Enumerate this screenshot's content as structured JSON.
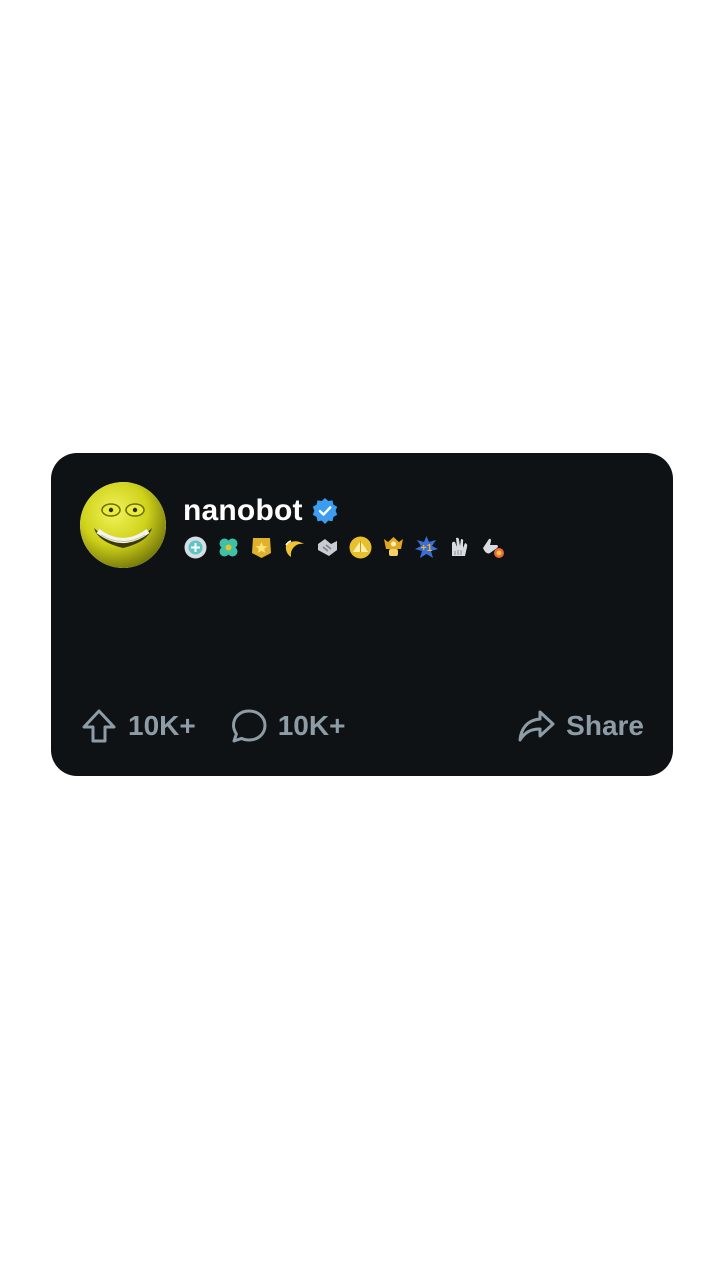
{
  "post": {
    "username": "nanobot",
    "verified": true,
    "badges": [
      {
        "icon": "teal-gem-badge-icon",
        "color": "#5cc6c4"
      },
      {
        "icon": "clover-badge-icon",
        "color": "#3fbfa6"
      },
      {
        "icon": "gold-star-badge-icon",
        "color": "#e0b12a"
      },
      {
        "icon": "banana-badge-icon",
        "color": "#f2c431"
      },
      {
        "icon": "handshake-badge-icon",
        "color": "#c9cdd2"
      },
      {
        "icon": "gold-pyramid-badge-icon",
        "color": "#e8c02e"
      },
      {
        "icon": "gold-trophy-badge-icon",
        "color": "#e4a81f"
      },
      {
        "icon": "plus-one-badge-icon",
        "color": "#f0b62e"
      },
      {
        "icon": "clap-badge-icon",
        "color": "#d8dce0"
      },
      {
        "icon": "rocket-hand-badge-icon",
        "color": "#e76a3a"
      }
    ],
    "upvotes": "10K+",
    "comments": "10K+",
    "share_label": "Share"
  },
  "colors": {
    "card_bg": "#0f1215",
    "action_text": "#8e9ca6",
    "verified_blue": "#3b9cf2",
    "avatar_yellow": "#d9dc1e"
  }
}
